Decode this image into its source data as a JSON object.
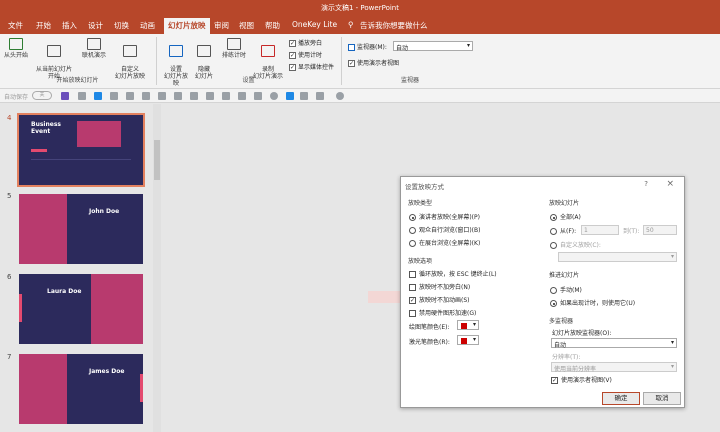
{
  "window": {
    "title": "演示文稿1 - PowerPoint"
  },
  "tabs": [
    "文件",
    "开始",
    "插入",
    "设计",
    "切换",
    "动画",
    "幻灯片放映",
    "审阅",
    "视图",
    "帮助",
    "OneKey Lite"
  ],
  "active_tab": "幻灯片放映",
  "search": {
    "placeholder": "告诉我你想要做什么"
  },
  "ribbon": {
    "from_start": "从头开始",
    "from_current": "从当前幻灯片\n开始",
    "online": "联机演示",
    "custom": "自定义\n幻灯片放映",
    "group_start": "开始放映幻灯片",
    "setup": "设置\n幻灯片放映",
    "hide": "隐藏\n幻灯片",
    "rehearse": "排练计时",
    "record": "录制\n幻灯片演示",
    "play_narration": "播放旁白",
    "use_timings": "使用计时",
    "show_media": "显示媒体控件",
    "group_setup": "设置",
    "monitor_label": "监视器(M):",
    "monitor_value": "自动",
    "presenter_view": "使用演示者视图",
    "group_monitors": "监视器"
  },
  "qat": {
    "autosave": "自动保存",
    "autosave_state": "关"
  },
  "slides": [
    {
      "num": "4",
      "title": "Business\nEvent",
      "selected": true
    },
    {
      "num": "5",
      "title": "John Doe"
    },
    {
      "num": "6",
      "title": "Laura Doe"
    },
    {
      "num": "7",
      "title": "James Doe"
    }
  ],
  "dialog": {
    "title": "设置放映方式",
    "help": "?",
    "show_type": {
      "label": "放映类型",
      "options": [
        "演讲者放映(全屏幕)(P)",
        "观众自行浏览(窗口)(B)",
        "在展台浏览(全屏幕)(K)"
      ],
      "selected": 0
    },
    "show_options": {
      "label": "放映选项",
      "items": [
        {
          "label": "循环放映，按 ESC 键终止(L)",
          "checked": false
        },
        {
          "label": "放映时不加旁白(N)",
          "checked": false
        },
        {
          "label": "放映时不加动画(S)",
          "checked": true
        },
        {
          "label": "禁用硬件图形加速(G)",
          "checked": false
        }
      ],
      "pen_color": "绘图笔颜色(E):",
      "laser_color": "激光笔颜色(R):"
    },
    "show_slides": {
      "label": "放映幻灯片",
      "all": "全部(A)",
      "from": "从(F):",
      "from_value": "1",
      "to": "到(T):",
      "to_value": "50",
      "custom": "自定义放映(C):"
    },
    "advance": {
      "label": "推进幻灯片",
      "manual": "手动(M)",
      "timings": "如果出现计时，则使用它(U)"
    },
    "monitors": {
      "label": "多监视器",
      "monitor_label": "幻灯片放映监视器(O):",
      "monitor_value": "自动",
      "resolution_label": "分辨率(T):",
      "resolution_value": "使用当前分辨率",
      "presenter": "使用演示者视图(V)"
    },
    "ok": "确定",
    "cancel": "取消"
  },
  "colors": {
    "accent": "#b7472a",
    "slide_bg": "#2c2a5c",
    "slide_pink": "#b83a6e"
  }
}
